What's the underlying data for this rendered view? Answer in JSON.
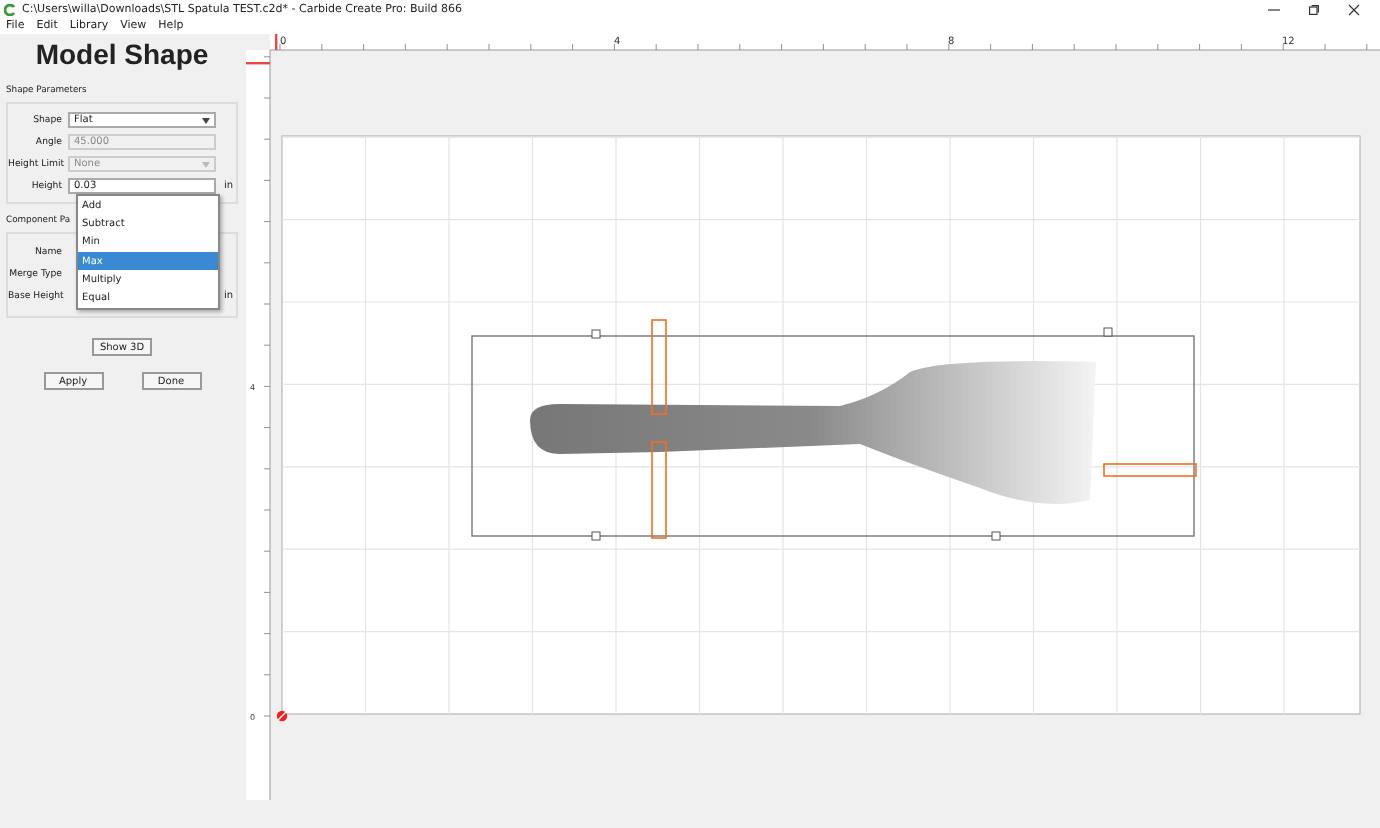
{
  "window": {
    "title": "C:\\Users\\willa\\Downloads\\STL Spatula TEST.c2d* - Carbide Create Pro: Build 866"
  },
  "menu": [
    "File",
    "Edit",
    "Library",
    "View",
    "Help"
  ],
  "panel": {
    "title": "Model Shape",
    "shape_section": {
      "title": "Shape Parameters",
      "fields": [
        {
          "label": "Shape",
          "kind": "select",
          "value": "Flat",
          "disabled": false
        },
        {
          "label": "Angle",
          "kind": "input",
          "value": "45.000",
          "disabled": true
        },
        {
          "label": "Height Limit",
          "kind": "select",
          "value": "None",
          "disabled": true
        },
        {
          "label": "Height",
          "kind": "input",
          "value": "0.03",
          "disabled": false,
          "unit": "in"
        }
      ]
    },
    "component_section": {
      "title": "Component Pa",
      "fields": [
        {
          "label": "Name"
        },
        {
          "label": "Merge Type"
        },
        {
          "label": "Base Height",
          "unit": "in"
        }
      ]
    },
    "dropdown": [
      {
        "label": "Add",
        "selected": false
      },
      {
        "label": "Subtract",
        "selected": false
      },
      {
        "label": "Min",
        "selected": false
      },
      {
        "label": "Max",
        "selected": true
      },
      {
        "label": "Multiply",
        "selected": false
      },
      {
        "label": "Equal",
        "selected": false
      }
    ],
    "show_button": "Show 3D",
    "buttons": [
      "Apply",
      "Done"
    ]
  },
  "ruler": {
    "x_labels": [
      "0",
      "4",
      "8",
      "12"
    ],
    "y_labels": [
      "4",
      "0"
    ]
  }
}
